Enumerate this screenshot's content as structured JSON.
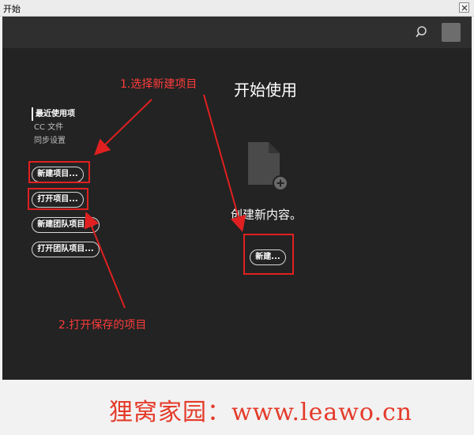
{
  "window": {
    "title": "开始"
  },
  "topbar": {
    "search_icon": "search-icon",
    "avatar_icon": "avatar"
  },
  "nav": {
    "items": [
      {
        "label": "最近使用项",
        "active": true
      },
      {
        "label": "CC 文件",
        "active": false
      },
      {
        "label": "同步设置",
        "active": false
      }
    ]
  },
  "sidebar_buttons": {
    "new_project": "新建项目...",
    "open_project": "打开项目...",
    "new_team_project": "新建团队项目...",
    "open_team_project": "打开团队项目..."
  },
  "main": {
    "title": "开始使用",
    "create_text": "创建新内容。",
    "new_button": "新建..."
  },
  "annotations": {
    "step1": "1.选择新建项目",
    "step2": "2.打开保存的项目",
    "color": "#e02020"
  },
  "watermark": "狸窝家园：www.leawo.cn"
}
